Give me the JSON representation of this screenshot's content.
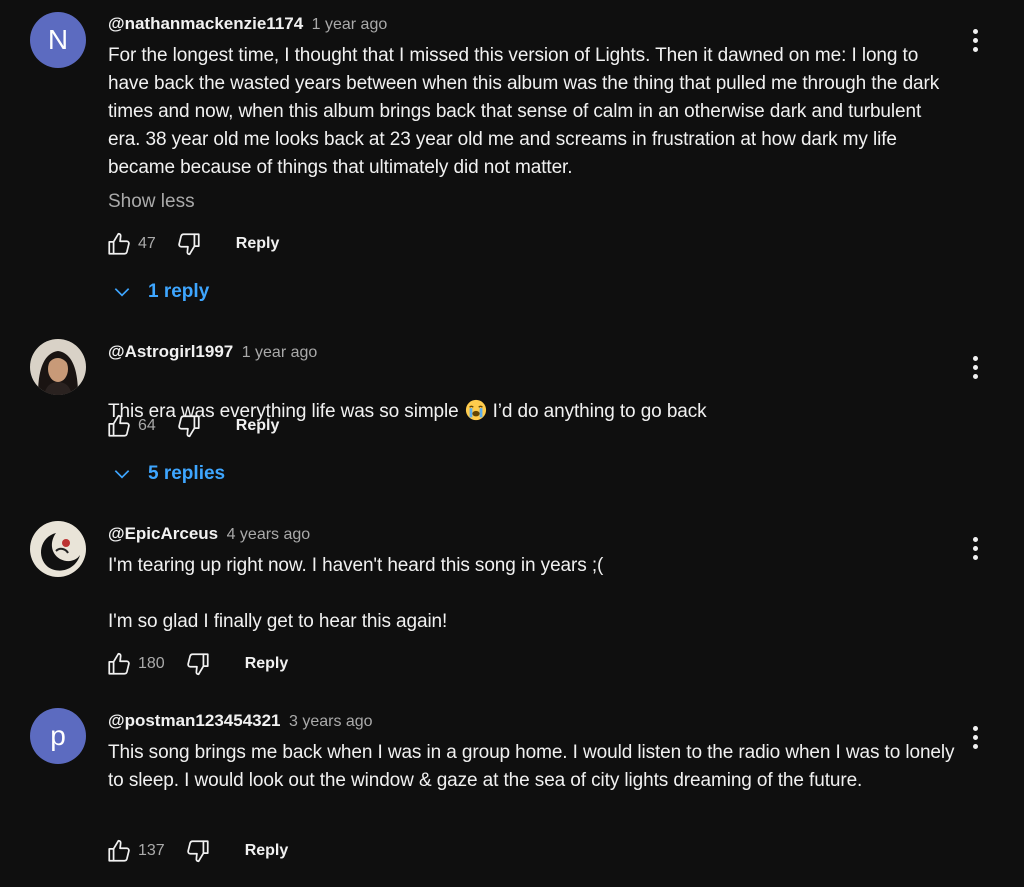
{
  "comments": [
    {
      "avatar_letter": "N",
      "author": "@nathanmackenzie1174",
      "time": "1 year ago",
      "text": "For the longest time, I thought that I missed this version of Lights. Then it dawned on me: I long to have back the wasted years between when this album was the thing that pulled me through the dark times and now, when this album brings back that sense of calm in an otherwise dark and turbulent era. 38 year old me looks back at 23 year old me and screams in frustration at how dark my life became because of things that ultimately did not matter.",
      "show_less": "Show less",
      "likes": "47",
      "reply_label": "Reply",
      "replies_label": "1 reply"
    },
    {
      "author": "@Astrogirl1997",
      "time": "1 year ago",
      "text_before_emoji": "This era was everything life was so simple",
      "emoji": "loudly-crying-face-emoji",
      "text_after_emoji": "I’d do anything to go back",
      "likes": "64",
      "reply_label": "Reply",
      "replies_label": "5 replies"
    },
    {
      "author": "@EpicArceus",
      "time": "4 years ago",
      "text": "I'm tearing up right now. I haven't heard this song in years ;(\n\nI'm so glad I finally get to hear this again!",
      "likes": "180",
      "reply_label": "Reply"
    },
    {
      "avatar_letter": "p",
      "author": "@postman123454321",
      "time": "3 years ago",
      "text": "This song brings me back when I was in a group home. I would listen to the radio when I was to lonely to sleep. I would look out the window & gaze at the sea of city lights dreaming of the future.",
      "likes": "137",
      "reply_label": "Reply"
    }
  ],
  "icons": {
    "like": "thumbs-up-icon",
    "dislike": "thumbs-down-icon",
    "menu": "more-vertical-icon",
    "expand": "chevron-down-icon"
  },
  "colors": {
    "background": "#0f0f0f",
    "text": "#f1f1f1",
    "secondary_text": "#aaaaaa",
    "link_blue": "#3ea6ff",
    "avatar_n": "#5c6bc0",
    "avatar_p": "#5c6bc0"
  }
}
